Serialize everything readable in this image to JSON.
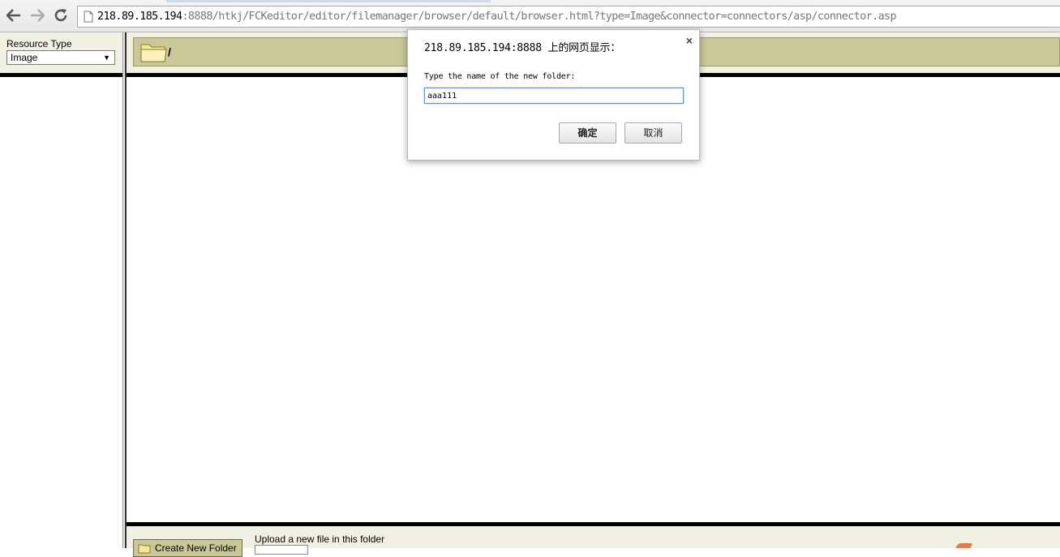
{
  "browser": {
    "url_host": "218.89.185.194",
    "url_rest": ":8888/htkj/FCKeditor/editor/filemanager/browser/default/browser.html?type=Image&connector=connectors/asp/connector.asp",
    "icons": [
      "back-arrow-icon",
      "forward-arrow-icon",
      "reload-icon",
      "page-icon"
    ]
  },
  "resource_panel": {
    "label": "Resource Type",
    "selected": "Image"
  },
  "folder_panel": {
    "path": "/"
  },
  "bottom": {
    "create_folder_label": "Create New Folder",
    "upload_label": "Upload a new file in this folder"
  },
  "dialog": {
    "title": "218.89.185.194:8888 上的网页显示：",
    "message": "Type the name of the new folder:",
    "input_value": "aaa111",
    "ok_label": "确定",
    "cancel_label": "取消",
    "close_glyph": "×"
  },
  "colors": {
    "panel_bg": "#f1f1e3",
    "folder_bar": "#cac896",
    "focus_ring": "#4d90fe"
  }
}
